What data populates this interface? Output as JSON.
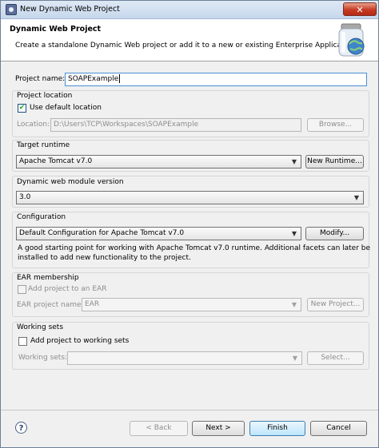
{
  "window": {
    "title": "New Dynamic Web Project",
    "close_glyph": "✕"
  },
  "banner": {
    "title": "Dynamic Web Project",
    "description": "Create a standalone Dynamic Web project or add it to a new or existing Enterprise Application."
  },
  "project_name": {
    "label": "Project name:",
    "value": "SOAPExample"
  },
  "project_location": {
    "group_label": "Project location",
    "use_default": {
      "label": "Use default location",
      "checked": true
    },
    "location_label": "Location:",
    "location_value": "D:\\Users\\TCP\\Workspaces\\SOAPExample",
    "browse_label": "Browse..."
  },
  "target_runtime": {
    "group_label": "Target runtime",
    "selected": "Apache Tomcat v7.0",
    "new_runtime_label": "New Runtime..."
  },
  "module_version": {
    "group_label": "Dynamic web module version",
    "selected": "3.0"
  },
  "configuration": {
    "group_label": "Configuration",
    "selected": "Default Configuration for Apache Tomcat v7.0",
    "modify_label": "Modify...",
    "description_line1": "A good starting point for working with Apache Tomcat v7.0 runtime. Additional facets can later be",
    "description_line2": "installed to add new functionality to the project."
  },
  "ear_membership": {
    "group_label": "EAR membership",
    "add_to_ear": {
      "label": "Add project to an EAR",
      "checked": false
    },
    "ear_name_label": "EAR project name:",
    "ear_name_value": "EAR",
    "new_project_label": "New Project..."
  },
  "working_sets": {
    "group_label": "Working sets",
    "add_to_working_sets": {
      "label": "Add project to working sets",
      "checked": false
    },
    "working_sets_label": "Working sets:",
    "working_sets_value": "",
    "select_label": "Select..."
  },
  "footer": {
    "help_glyph": "?",
    "back_label": "< Back",
    "next_label": "Next >",
    "finish_label": "Finish",
    "cancel_label": "Cancel"
  },
  "icons": {
    "app": "eclipse-app-icon",
    "help": "help-icon",
    "banner": "web-project-jar-globe-icon",
    "checkmark": "✔",
    "combo_arrow": "▼"
  }
}
